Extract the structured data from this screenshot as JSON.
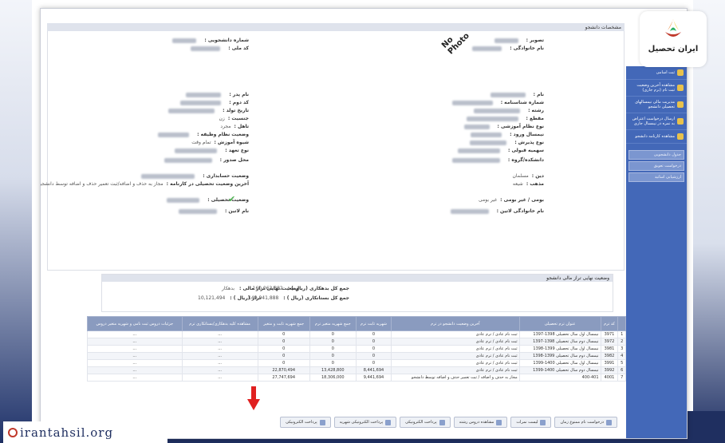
{
  "brand": {
    "name": "ایران تحصیل",
    "watermark": "irantahsil.org"
  },
  "panel": {
    "title": "مشخصات دانشجو",
    "photo_text": "No Photo"
  },
  "profile_left": [
    {
      "label": "شماره دانشجویی :",
      "value": ""
    },
    {
      "label": "کد ملی :",
      "value": ""
    },
    {
      "label": "نام پدر :",
      "value": ""
    },
    {
      "label": "کد دوم :",
      "value": ""
    },
    {
      "label": "تاریخ تولد :",
      "value": ""
    },
    {
      "label": "جنسیت :",
      "value": "زن"
    },
    {
      "label": "تاهل :",
      "value": "مجرد"
    },
    {
      "label": "وضعیت نظام وظیفه :",
      "value": ""
    },
    {
      "label": "شیوه آموزش :",
      "value": "تمام وقت"
    },
    {
      "label": "نوع تعهد :",
      "value": ""
    },
    {
      "label": "محل صدور :",
      "value": ""
    },
    {
      "label": "وضعیت حسابداری :",
      "value": ""
    },
    {
      "label": "آخرین وضعیت تحصیلی در کارنامه :",
      "value": "مجاز به حذف و اضافه/ثبت تعمیر حذف و اضافه توسط دانشجو"
    },
    {
      "label": "وضعیت تحصیلی :",
      "value": ""
    },
    {
      "label": "نام لاتین :",
      "value": ""
    }
  ],
  "profile_right": [
    {
      "label": "تصویر :",
      "value": ""
    },
    {
      "label": "نام خانوادگی :",
      "value": ""
    },
    {
      "label": "نام :",
      "value": ""
    },
    {
      "label": "شماره شناسنامه :",
      "value": ""
    },
    {
      "label": "رشته :",
      "value": ""
    },
    {
      "label": "مقطع :",
      "value": ""
    },
    {
      "label": "نوع نظام آموزشی :",
      "value": ""
    },
    {
      "label": "نیمسال ورود :",
      "value": ""
    },
    {
      "label": "نوع پذیرش :",
      "value": ""
    },
    {
      "label": "سهمیه قبولی :",
      "value": ""
    },
    {
      "label": "دانشکده/گروه :",
      "value": ""
    },
    {
      "label": "دین :",
      "value": "مسلمان"
    },
    {
      "label": "مذهب :",
      "value": "شیعه"
    },
    {
      "label": "بومی / غیر بومی :",
      "value": "غیر بومی"
    },
    {
      "label": "نام خانوادگی لاتین :",
      "value": ""
    }
  ],
  "finance": {
    "title": "وضعیت نهایی تراز مالی دانشجو",
    "debt_label": "جمع کل بدهکاری (ریال ) :",
    "debt_value": "160,063,382",
    "credit_label": "جمع کل بستانکاری (ریال ) :",
    "credit_value": "149,941,888",
    "status_label": "وضعیت نهایی تراز مالی :",
    "status_value": "بدهکار",
    "balance_label": "تراز (ریال ) :",
    "balance_value": "10,121,494"
  },
  "terms": {
    "headers": [
      "",
      "کد ترم",
      "عنوان ترم تحصیلی",
      "آخرین وضعیت دانشجو در ترم",
      "شهریه ثابت ترم",
      "جمع شهریه متغیر ترم",
      "جمع شهریه ثابت و متغیر",
      "مشاهده کلیه بدهکاری/بستانکاری ترم",
      "جزئیات دروس ثبت نامی و شهریه متغیر دروس"
    ],
    "rows": [
      {
        "n": "1",
        "code": "3971",
        "title": "نیمسال اول سال تحصیلی 1398-1397",
        "status": "ثبت نام عادی / ترم عادی",
        "fixed": "0",
        "var": "0",
        "sum": "0",
        "ledger": "...",
        "detail": "..."
      },
      {
        "n": "2",
        "code": "3972",
        "title": "نیمسال دوم سال تحصیلی 1398-1397",
        "status": "ثبت نام عادی / ترم عادی",
        "fixed": "0",
        "var": "0",
        "sum": "0",
        "ledger": "...",
        "detail": "..."
      },
      {
        "n": "3",
        "code": "3981",
        "title": "نیمسال اول سال تحصیلی 1399-1398",
        "status": "ثبت نام عادی / ترم عادی",
        "fixed": "0",
        "var": "0",
        "sum": "0",
        "ledger": "...",
        "detail": "..."
      },
      {
        "n": "4",
        "code": "3982",
        "title": "نیمسال دوم سال تحصیلی 1399-1398",
        "status": "ثبت نام عادی / ترم عادی",
        "fixed": "0",
        "var": "0",
        "sum": "0",
        "ledger": "...",
        "detail": "..."
      },
      {
        "n": "5",
        "code": "3991",
        "title": "نیمسال اول سال تحصیلی 1400-1399",
        "status": "ثبت نام عادی / ترم عادی",
        "fixed": "0",
        "var": "0",
        "sum": "0",
        "ledger": "...",
        "detail": "..."
      },
      {
        "n": "6",
        "code": "3992",
        "title": "نیمسال دوم سال تحصیلی 1400-1399",
        "status": "ثبت نام عادی / ترم عادی",
        "fixed": "8,441,694",
        "var": "13,428,800",
        "sum": "22,870,494",
        "ledger": "...",
        "detail": "..."
      },
      {
        "n": "7",
        "code": "4001",
        "title": "400-401",
        "status": "مجاز به حذف و اضافه / ثبت تعمیر حذف و اضافه توسط دانشجو",
        "fixed": "9,441,694",
        "var": "18,306,000",
        "sum": "27,747,694",
        "ledger": "...",
        "detail": "..."
      }
    ]
  },
  "sidebar": {
    "items": [
      "ثبت اسامی",
      "مشاهده آخرین وضعیت ثبت نام (ترم جاری)",
      "مدیریت مالی نیمسالهای تحصیلی دانشجو",
      "ارسال درخواست اعتراض به نمره در نیمسال جاری",
      "مشاهده کارنامه دانشجو"
    ],
    "links": [
      "جدول دانشجویی",
      "درخواست تعویق",
      "ارزشیابی اساتید"
    ]
  },
  "toolbar": {
    "buttons": [
      "درخواست نام ممنوع زمان",
      "لیست نمرات",
      "مشاهده دروس رشته",
      "پرداخت الکترونیکی",
      "پرداخت الکترونیکی شهریه",
      "پرداخت الکترونیکی"
    ]
  },
  "colors": {
    "accent": "#4368b8",
    "table_header": "#8a9bbf",
    "arrow": "#e02020"
  }
}
